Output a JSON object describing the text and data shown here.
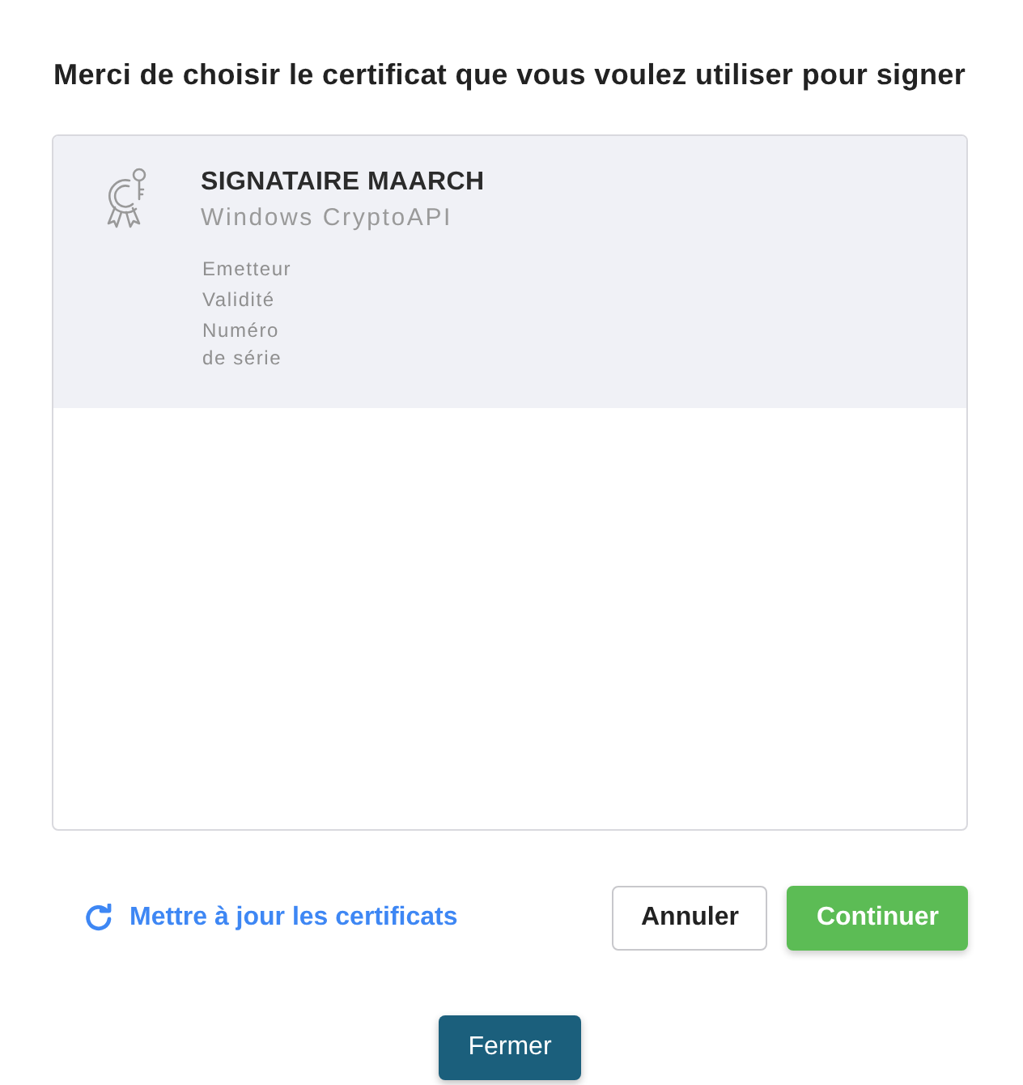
{
  "title": "Merci de choisir le certificat que vous voulez utiliser pour signer",
  "certificates": [
    {
      "name": "SIGNATAIRE MAARCH",
      "provider": "Windows CryptoAPI",
      "selected": true,
      "fields": [
        "Emetteur",
        "Validité",
        "Numéro de série"
      ]
    }
  ],
  "refresh_link": "Mettre à jour les certificats",
  "buttons": [
    {
      "label": "Annuler",
      "kind": "secondary"
    },
    {
      "label": "Continuer",
      "kind": "primary"
    }
  ],
  "close_button": "Fermer"
}
